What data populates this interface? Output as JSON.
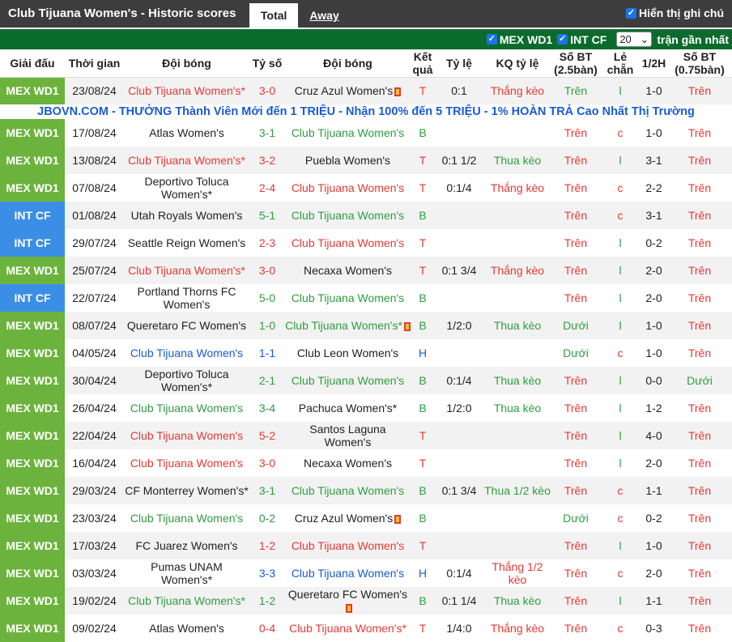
{
  "header": {
    "title": "Club Tijuana Women's - Historic scores",
    "tabs": [
      "Total",
      "Away"
    ],
    "show_note_label": "Hiển thị ghi chú"
  },
  "filters": {
    "league1": "MEX WD1",
    "league2": "INT CF",
    "count": "20",
    "recent_label": "trận gần nhất"
  },
  "columns": [
    "Giải đấu",
    "Thời gian",
    "Đội bóng",
    "Tỷ số",
    "Đội bóng",
    "Kết quả",
    "Tỷ lệ",
    "KQ tỷ lệ",
    "Số BT (2.5bàn)",
    "Lẻ chẵn",
    "1/2H",
    "Số BT (0.75bàn)"
  ],
  "ad_text": "JBOVN.COM - THƯỞNG Thành Viên Mới đến 1 TRIỆU - Nhận 100% đến 5 TRIỆU - 1% HOÀN TRẢ Cao Nhất Thị Trường",
  "colors": {
    "red": "#e53935",
    "green": "#2e9e3e",
    "blue": "#1a5bd6",
    "league_mex": "#6cb33e",
    "league_intcf": "#3a8ee6",
    "header_bg": "#3d3d3d",
    "filter_bg": "#0b6b2d"
  },
  "rows": [
    {
      "league": "MEX WD1",
      "date": "23/08/24",
      "home": "Club Tijuana Women's*",
      "home_c": "red",
      "score": "3-0",
      "away": "Cruz Azul Women's",
      "away_c": "gray",
      "away_rc": true,
      "home_rc": false,
      "res": "T",
      "res_c": "red",
      "hcp": "0:1",
      "hres": "Thắng kèo",
      "hres_c": "red",
      "ou": "Trên",
      "ou_c": "green",
      "oe": "l",
      "oe_c": "green",
      "half": "1-0",
      "ou2": "Trên",
      "ou2_c": "red"
    },
    {
      "league": "MEX WD1",
      "date": "17/08/24",
      "home": "Atlas Women's",
      "home_c": "gray",
      "score": "3-1",
      "away": "Club Tijuana Women's",
      "away_c": "green",
      "away_rc": false,
      "home_rc": false,
      "res": "B",
      "res_c": "green",
      "hcp": "",
      "hres": "",
      "hres_c": "red",
      "ou": "Trên",
      "ou_c": "red",
      "oe": "c",
      "oe_c": "red",
      "half": "1-0",
      "ou2": "Trên",
      "ou2_c": "red"
    },
    {
      "league": "MEX WD1",
      "date": "13/08/24",
      "home": "Club Tijuana Women's*",
      "home_c": "red",
      "score": "3-2",
      "away": "Puebla Women's",
      "away_c": "gray",
      "away_rc": false,
      "home_rc": false,
      "res": "T",
      "res_c": "red",
      "hcp": "0:1 1/2",
      "hres": "Thua kèo",
      "hres_c": "green",
      "ou": "Trên",
      "ou_c": "red",
      "oe": "l",
      "oe_c": "green",
      "half": "3-1",
      "ou2": "Trên",
      "ou2_c": "red"
    },
    {
      "league": "MEX WD1",
      "date": "07/08/24",
      "home": "Deportivo Toluca Women's*",
      "home_c": "gray",
      "score": "2-4",
      "away": "Club Tijuana Women's",
      "away_c": "red",
      "away_rc": false,
      "home_rc": false,
      "res": "T",
      "res_c": "red",
      "hcp": "0:1/4",
      "hres": "Thắng kèo",
      "hres_c": "red",
      "ou": "Trên",
      "ou_c": "red",
      "oe": "c",
      "oe_c": "red",
      "half": "2-2",
      "ou2": "Trên",
      "ou2_c": "red"
    },
    {
      "league": "INT CF",
      "date": "01/08/24",
      "home": "Utah Royals Women's",
      "home_c": "gray",
      "score": "5-1",
      "away": "Club Tijuana Women's",
      "away_c": "green",
      "away_rc": false,
      "home_rc": false,
      "res": "B",
      "res_c": "green",
      "hcp": "",
      "hres": "",
      "hres_c": "red",
      "ou": "Trên",
      "ou_c": "red",
      "oe": "c",
      "oe_c": "red",
      "half": "3-1",
      "ou2": "Trên",
      "ou2_c": "red"
    },
    {
      "league": "INT CF",
      "date": "29/07/24",
      "home": "Seattle Reign Women's",
      "home_c": "gray",
      "score": "2-3",
      "away": "Club Tijuana Women's",
      "away_c": "red",
      "away_rc": false,
      "home_rc": false,
      "res": "T",
      "res_c": "red",
      "hcp": "",
      "hres": "",
      "hres_c": "red",
      "ou": "Trên",
      "ou_c": "red",
      "oe": "l",
      "oe_c": "green",
      "half": "0-2",
      "ou2": "Trên",
      "ou2_c": "red"
    },
    {
      "league": "MEX WD1",
      "date": "25/07/24",
      "home": "Club Tijuana Women's*",
      "home_c": "red",
      "score": "3-0",
      "away": "Necaxa Women's",
      "away_c": "gray",
      "away_rc": false,
      "home_rc": false,
      "res": "T",
      "res_c": "red",
      "hcp": "0:1 3/4",
      "hres": "Thắng kèo",
      "hres_c": "red",
      "ou": "Trên",
      "ou_c": "red",
      "oe": "l",
      "oe_c": "green",
      "half": "2-0",
      "ou2": "Trên",
      "ou2_c": "red"
    },
    {
      "league": "INT CF",
      "date": "22/07/24",
      "home": "Portland Thorns FC Women's",
      "home_c": "gray",
      "score": "5-0",
      "away": "Club Tijuana Women's",
      "away_c": "green",
      "away_rc": false,
      "home_rc": false,
      "res": "B",
      "res_c": "green",
      "hcp": "",
      "hres": "",
      "hres_c": "red",
      "ou": "Trên",
      "ou_c": "red",
      "oe": "l",
      "oe_c": "green",
      "half": "2-0",
      "ou2": "Trên",
      "ou2_c": "red"
    },
    {
      "league": "MEX WD1",
      "date": "08/07/24",
      "home": "Queretaro FC Women's",
      "home_c": "gray",
      "score": "1-0",
      "away": "Club Tijuana Women's*",
      "away_c": "green",
      "away_rc": true,
      "home_rc": false,
      "res": "B",
      "res_c": "green",
      "hcp": "1/2:0",
      "hres": "Thua kèo",
      "hres_c": "green",
      "ou": "Dưới",
      "ou_c": "green",
      "oe": "l",
      "oe_c": "green",
      "half": "1-0",
      "ou2": "Trên",
      "ou2_c": "red"
    },
    {
      "league": "MEX WD1",
      "date": "04/05/24",
      "home": "Club Tijuana Women's",
      "home_c": "blue",
      "score": "1-1",
      "away": "Club Leon Women's",
      "away_c": "gray",
      "away_rc": false,
      "home_rc": false,
      "res": "H",
      "res_c": "blue",
      "hcp": "",
      "hres": "",
      "hres_c": "red",
      "ou": "Dưới",
      "ou_c": "green",
      "oe": "c",
      "oe_c": "red",
      "half": "1-0",
      "ou2": "Trên",
      "ou2_c": "red"
    },
    {
      "league": "MEX WD1",
      "date": "30/04/24",
      "home": "Deportivo Toluca Women's*",
      "home_c": "gray",
      "score": "2-1",
      "away": "Club Tijuana Women's",
      "away_c": "green",
      "away_rc": false,
      "home_rc": false,
      "res": "B",
      "res_c": "green",
      "hcp": "0:1/4",
      "hres": "Thua kèo",
      "hres_c": "green",
      "ou": "Trên",
      "ou_c": "red",
      "oe": "l",
      "oe_c": "green",
      "half": "0-0",
      "ou2": "Dưới",
      "ou2_c": "green"
    },
    {
      "league": "MEX WD1",
      "date": "26/04/24",
      "home": "Club Tijuana Women's",
      "home_c": "green",
      "score": "3-4",
      "away": "Pachuca Women's*",
      "away_c": "gray",
      "away_rc": false,
      "home_rc": false,
      "res": "B",
      "res_c": "green",
      "hcp": "1/2:0",
      "hres": "Thua kèo",
      "hres_c": "green",
      "ou": "Trên",
      "ou_c": "red",
      "oe": "l",
      "oe_c": "green",
      "half": "1-2",
      "ou2": "Trên",
      "ou2_c": "red"
    },
    {
      "league": "MEX WD1",
      "date": "22/04/24",
      "home": "Club Tijuana Women's",
      "home_c": "red",
      "score": "5-2",
      "away": "Santos Laguna Women's",
      "away_c": "gray",
      "away_rc": false,
      "home_rc": false,
      "res": "T",
      "res_c": "red",
      "hcp": "",
      "hres": "",
      "hres_c": "red",
      "ou": "Trên",
      "ou_c": "red",
      "oe": "l",
      "oe_c": "green",
      "half": "4-0",
      "ou2": "Trên",
      "ou2_c": "red"
    },
    {
      "league": "MEX WD1",
      "date": "16/04/24",
      "home": "Club Tijuana Women's",
      "home_c": "red",
      "score": "3-0",
      "away": "Necaxa Women's",
      "away_c": "gray",
      "away_rc": false,
      "home_rc": false,
      "res": "T",
      "res_c": "red",
      "hcp": "",
      "hres": "",
      "hres_c": "red",
      "ou": "Trên",
      "ou_c": "red",
      "oe": "l",
      "oe_c": "green",
      "half": "2-0",
      "ou2": "Trên",
      "ou2_c": "red"
    },
    {
      "league": "MEX WD1",
      "date": "29/03/24",
      "home": "CF Monterrey Women's*",
      "home_c": "gray",
      "score": "3-1",
      "away": "Club Tijuana Women's",
      "away_c": "green",
      "away_rc": false,
      "home_rc": false,
      "res": "B",
      "res_c": "green",
      "hcp": "0:1 3/4",
      "hres": "Thua 1/2 kèo",
      "hres_c": "green",
      "ou": "Trên",
      "ou_c": "red",
      "oe": "c",
      "oe_c": "red",
      "half": "1-1",
      "ou2": "Trên",
      "ou2_c": "red"
    },
    {
      "league": "MEX WD1",
      "date": "23/03/24",
      "home": "Club Tijuana Women's",
      "home_c": "green",
      "score": "0-2",
      "away": "Cruz Azul Women's",
      "away_c": "gray",
      "away_rc": true,
      "home_rc": false,
      "res": "B",
      "res_c": "green",
      "hcp": "",
      "hres": "",
      "hres_c": "red",
      "ou": "Dưới",
      "ou_c": "green",
      "oe": "c",
      "oe_c": "red",
      "half": "0-2",
      "ou2": "Trên",
      "ou2_c": "red"
    },
    {
      "league": "MEX WD1",
      "date": "17/03/24",
      "home": "FC Juarez Women's",
      "home_c": "gray",
      "score": "1-2",
      "away": "Club Tijuana Women's",
      "away_c": "red",
      "away_rc": false,
      "home_rc": false,
      "res": "T",
      "res_c": "red",
      "hcp": "",
      "hres": "",
      "hres_c": "red",
      "ou": "Trên",
      "ou_c": "red",
      "oe": "l",
      "oe_c": "green",
      "half": "1-0",
      "ou2": "Trên",
      "ou2_c": "red"
    },
    {
      "league": "MEX WD1",
      "date": "03/03/24",
      "home": "Pumas UNAM Women's*",
      "home_c": "gray",
      "score": "3-3",
      "away": "Club Tijuana Women's",
      "away_c": "blue",
      "away_rc": false,
      "home_rc": false,
      "res": "H",
      "res_c": "blue",
      "hcp": "0:1/4",
      "hres": "Thắng 1/2 kèo",
      "hres_c": "red",
      "ou": "Trên",
      "ou_c": "red",
      "oe": "c",
      "oe_c": "red",
      "half": "2-0",
      "ou2": "Trên",
      "ou2_c": "red"
    },
    {
      "league": "MEX WD1",
      "date": "19/02/24",
      "home": "Club Tijuana Women's*",
      "home_c": "green",
      "score": "1-2",
      "away": "Queretaro FC Women's",
      "away_c": "gray",
      "away_rc": true,
      "home_rc": false,
      "res": "B",
      "res_c": "green",
      "hcp": "0:1 1/4",
      "hres": "Thua kèo",
      "hres_c": "green",
      "ou": "Trên",
      "ou_c": "red",
      "oe": "l",
      "oe_c": "green",
      "half": "1-1",
      "ou2": "Trên",
      "ou2_c": "red"
    },
    {
      "league": "MEX WD1",
      "date": "09/02/24",
      "home": "Atlas Women's",
      "home_c": "gray",
      "score": "0-4",
      "away": "Club Tijuana Women's*",
      "away_c": "red",
      "away_rc": false,
      "home_rc": false,
      "res": "T",
      "res_c": "red",
      "hcp": "1/4:0",
      "hres": "Thắng kèo",
      "hres_c": "red",
      "ou": "Trên",
      "ou_c": "red",
      "oe": "c",
      "oe_c": "red",
      "half": "0-3",
      "ou2": "Trên",
      "ou2_c": "red"
    }
  ]
}
